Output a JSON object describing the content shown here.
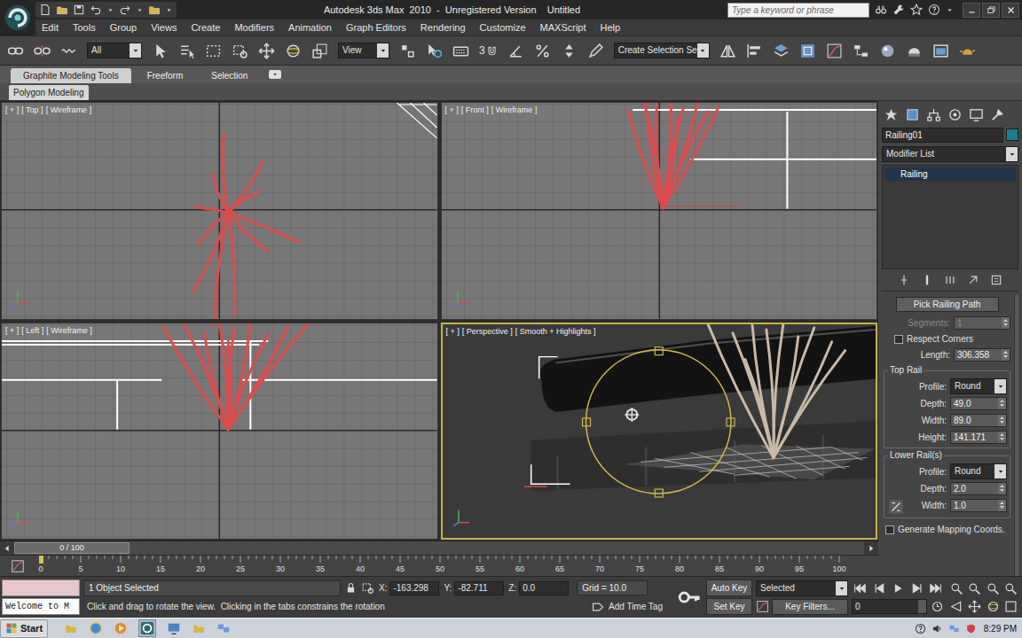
{
  "app": {
    "title": "Autodesk 3ds Max  2010  -  Unregistered Version    Untitled",
    "search_placeholder": "Type a keyword or phrase"
  },
  "menu": [
    "Edit",
    "Tools",
    "Group",
    "Views",
    "Create",
    "Modifiers",
    "Animation",
    "Graph Editors",
    "Rendering",
    "Customize",
    "MAXScript",
    "Help"
  ],
  "toolbar": {
    "selection_filter": "All",
    "reference_coordinate": "View",
    "snap_label": "3",
    "named_selection": "Create Selection Se"
  },
  "ribbon": {
    "tabs": [
      {
        "label": "Graphite Modeling Tools",
        "selected": true
      },
      {
        "label": "Freeform",
        "selected": false
      },
      {
        "label": "Selection",
        "selected": false
      }
    ],
    "panel": "Polygon Modeling"
  },
  "viewports": [
    {
      "kind": "top",
      "labels": [
        "[ + ]",
        "[ Top ]",
        "[ Wireframe ]"
      ],
      "active": false
    },
    {
      "kind": "front",
      "labels": [
        "[ + ]",
        "[ Front ]",
        "[ Wireframe ]"
      ],
      "active": false
    },
    {
      "kind": "left",
      "labels": [
        "[ + ]",
        "[ Left ]",
        "[ Wireframe ]"
      ],
      "active": false
    },
    {
      "kind": "perspective",
      "labels": [
        "[ + ]",
        "[ Perspective ]",
        "[ Smooth + Highlights ]"
      ],
      "active": true
    }
  ],
  "command_panel": {
    "object_name": "Railing01",
    "object_color": "#17808f",
    "modifier_list": "Modifier List",
    "stack": [
      {
        "label": "Railing",
        "selected": true
      }
    ],
    "pick_button": "Pick Railing Path",
    "segments": {
      "label": "Segments:",
      "value": "1",
      "disabled": true
    },
    "respect_corners": {
      "label": "Respect Corners",
      "checked": false
    },
    "length": {
      "label": "Length:",
      "value": "306.358"
    },
    "groups": [
      {
        "title": "Top Rail",
        "fields": [
          {
            "label": "Profile:",
            "value": "Round",
            "kind": "dropdown"
          },
          {
            "label": "Depth:",
            "value": "49.0",
            "kind": "spinner"
          },
          {
            "label": "Width:",
            "value": "89.0",
            "kind": "spinner"
          },
          {
            "label": "Height:",
            "value": "141.171",
            "kind": "spinner"
          }
        ]
      },
      {
        "title": "Lower Rail(s)",
        "fields": [
          {
            "label": "Profile:",
            "value": "Round",
            "kind": "dropdown"
          },
          {
            "label": "Depth:",
            "value": "2.0",
            "kind": "spinner"
          },
          {
            "label": "Width:",
            "value": "1.0",
            "kind": "spinner"
          }
        ]
      }
    ],
    "generate_mapping": {
      "label": "Generate Mapping Coords.",
      "checked": false
    }
  },
  "timeline": {
    "frame_display": "0 / 100",
    "level": 0,
    "ticks": [
      "0",
      "5",
      "10",
      "15",
      "20",
      "25",
      "30",
      "35",
      "40",
      "45",
      "50",
      "55",
      "60",
      "65",
      "70",
      "75",
      "80",
      "85",
      "90",
      "95",
      "100"
    ]
  },
  "status_bar": {
    "listener": "Welcome to M",
    "selection": "1 Object Selected",
    "coords": [
      {
        "label": "X:",
        "value": "-163.298"
      },
      {
        "label": "Y:",
        "value": "-82.711"
      },
      {
        "label": "Z:",
        "value": "0.0"
      }
    ],
    "grid": "Grid = 10.0",
    "prompt": "Click and drag to rotate the view.  Clicking in the tabs constrains the rotation",
    "time_tag": "Add Time Tag",
    "auto_key": "Auto Key",
    "set_key": "Set Key",
    "key_mode": "Selected",
    "key_filters": "Key Filters...",
    "frame": "0"
  },
  "taskbar": {
    "start": "Start",
    "clock": "8:29 PM"
  }
}
